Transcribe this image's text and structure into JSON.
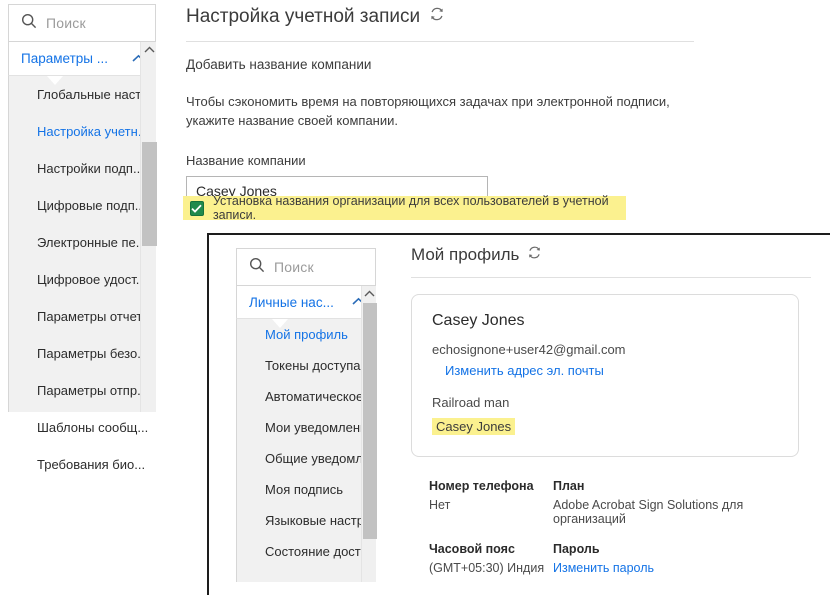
{
  "outer": {
    "search": {
      "placeholder": "Поиск",
      "icon": "search-icon"
    },
    "group": {
      "label": "Параметры ...",
      "icon": "chevron-up-icon"
    },
    "nav_items": [
      {
        "label": "Глобальные наст...",
        "selected": false
      },
      {
        "label": "Настройка учетн...",
        "selected": true
      },
      {
        "label": "Настройки подп...",
        "selected": false
      },
      {
        "label": "Цифровые подп...",
        "selected": false
      },
      {
        "label": "Электронные пе...",
        "selected": false
      },
      {
        "label": "Цифровое удост...",
        "selected": false
      },
      {
        "label": "Параметры отчета",
        "selected": false
      },
      {
        "label": "Параметры безо...",
        "selected": false
      },
      {
        "label": "Параметры отпр...",
        "selected": false
      },
      {
        "label": "Шаблоны сообщ...",
        "selected": false
      },
      {
        "label": "Требования био...",
        "selected": false
      }
    ],
    "page_title": "Настройка учетной записи",
    "refresh_icon": "refresh-icon",
    "sub_head": "Добавить название компании",
    "body_text": "Чтобы сэкономить время на повторяющихся задачах при электронной подписи, укажите название своей компании.",
    "field_label": "Название компании",
    "company_value": "Casey Jones",
    "company_placeholder": "Название компании",
    "checkbox": {
      "checked": true,
      "glyph": "✔",
      "label": "Установка названия организации для всех пользователей в учетной записи.",
      "highlight_color": "#fbf18f",
      "check_color": "#1f8a4c"
    }
  },
  "inner": {
    "search": {
      "placeholder": "Поиск",
      "icon": "search-icon"
    },
    "group": {
      "label": "Личные нас...",
      "icon": "chevron-up-icon"
    },
    "nav_items": [
      {
        "label": "Мой профиль",
        "selected": true
      },
      {
        "label": "Токены доступа",
        "selected": false
      },
      {
        "label": "Автоматическое ...",
        "selected": false
      },
      {
        "label": "Мои уведомления",
        "selected": false
      },
      {
        "label": "Общие уведомл...",
        "selected": false
      },
      {
        "label": "Моя подпись",
        "selected": false
      },
      {
        "label": "Языковые настр...",
        "selected": false
      },
      {
        "label": "Состояние досту...",
        "selected": false
      }
    ],
    "page_title": "Мой профиль",
    "refresh_icon": "refresh-icon",
    "profile": {
      "name": "Casey Jones",
      "email": "echosignone+user42@gmail.com",
      "change_email_link": "Изменить адрес эл. почты",
      "job_title": "Railroad man",
      "company": "Casey Jones",
      "company_highlight_color": "#fbf18f"
    },
    "info": [
      {
        "label": "Номер телефона",
        "value": "Нет",
        "is_link": false
      },
      {
        "label": "План",
        "value": "Adobe Acrobat Sign Solutions для организаций",
        "is_link": false
      },
      {
        "label": "Часовой пояс",
        "value": "(GMT+05:30) Индия",
        "is_link": false
      },
      {
        "label": "Пароль",
        "value": "Изменить пароль",
        "is_link": true
      }
    ]
  },
  "theme": {
    "accent": "#1473e6",
    "highlight": "#fbf18f",
    "check_green": "#1f8a4c",
    "nav_bg": "#f1f1f1"
  }
}
